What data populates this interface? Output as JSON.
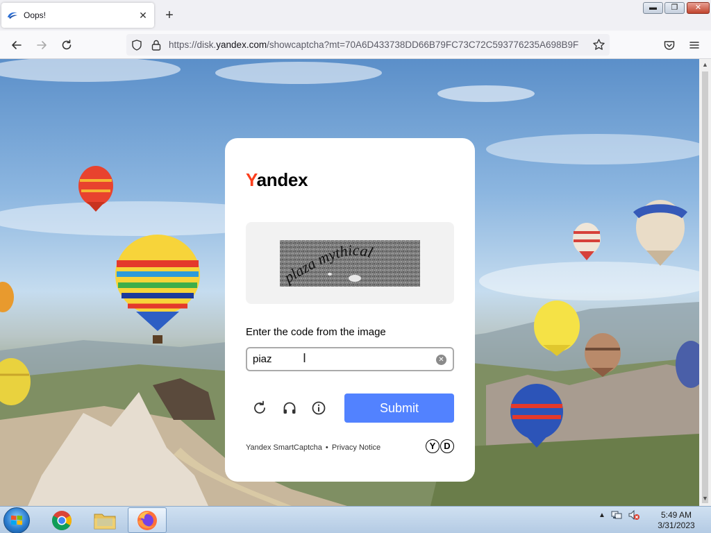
{
  "browser": {
    "tab_title": "Oops!",
    "new_tab_label": "+",
    "url_prefix": "https://disk.",
    "url_host": "yandex.com",
    "url_rest": "/showcaptcha?mt=70A6D433738DD66B79FC73C72C593776235A698B9F"
  },
  "captcha": {
    "brand_first": "Y",
    "brand_rest": "andex",
    "captcha_words": "plaza mythical",
    "prompt": "Enter the code from the image",
    "input_value": "piaz",
    "submit_label": "Submit",
    "footer_product": "Yandex SmartCaptcha",
    "footer_separator": "•",
    "footer_link": "Privacy Notice",
    "logo_letters": [
      "Y",
      "D"
    ]
  },
  "taskbar": {
    "time": "5:49 AM",
    "date": "3/31/2023"
  },
  "colors": {
    "brand_red": "#fc3f1d",
    "submit_blue": "#5282ff"
  }
}
